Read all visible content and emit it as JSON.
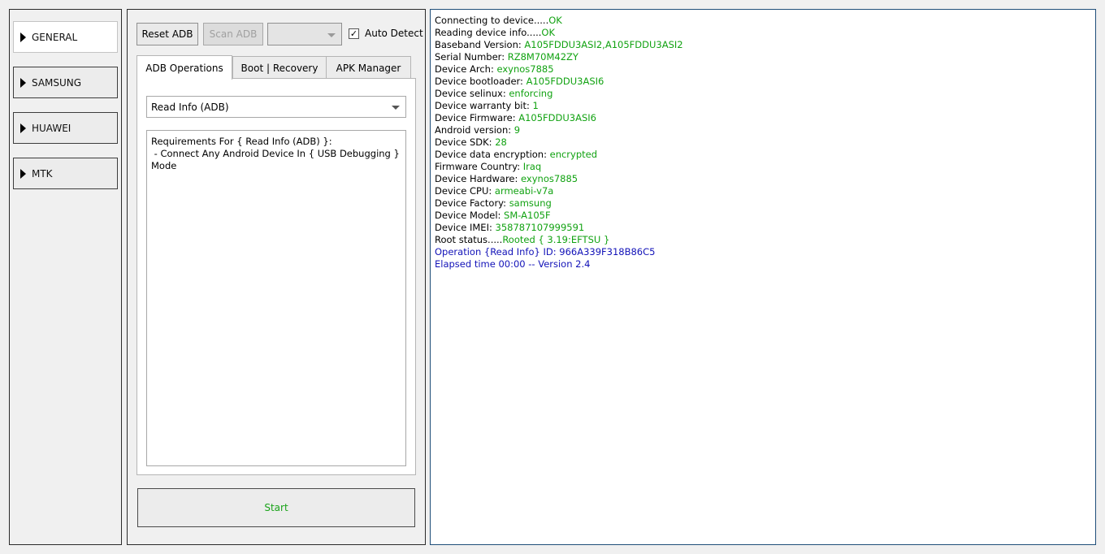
{
  "sidebar": {
    "items": [
      {
        "label": "GENERAL",
        "active": true
      },
      {
        "label": "SAMSUNG",
        "active": false
      },
      {
        "label": "HUAWEI",
        "active": false
      },
      {
        "label": "MTK",
        "active": false
      }
    ]
  },
  "toolbar": {
    "reset_adb": "Reset ADB",
    "scan_adb": "Scan ADB",
    "device_combo_value": "",
    "auto_detect_label": "Auto Detect",
    "auto_detect_checked": true
  },
  "tabs": [
    {
      "label": "ADB Operations",
      "active": true
    },
    {
      "label": "Boot | Recovery",
      "active": false
    },
    {
      "label": "APK Manager",
      "active": false
    }
  ],
  "operation_select": {
    "value": "Read Info (ADB)"
  },
  "requirements_text": "Requirements For { Read Info (ADB) }:\n - Connect Any Android Device In { USB Debugging }\nMode",
  "start_label": "Start",
  "colors": {
    "value_green": "#11a211",
    "info_blue": "#1212b8",
    "start_green": "#1aa31a"
  },
  "log": {
    "lines": [
      {
        "label": "Connecting to device.....",
        "value": "OK"
      },
      {
        "label": "Reading device info.....",
        "value": "OK"
      },
      {
        "label": "Baseband Version: ",
        "value": "A105FDDU3ASI2,A105FDDU3ASI2"
      },
      {
        "label": "Serial Number: ",
        "value": "RZ8M70M42ZY"
      },
      {
        "label": "Device Arch: ",
        "value": "exynos7885"
      },
      {
        "label": "Device bootloader: ",
        "value": "A105FDDU3ASI6"
      },
      {
        "label": "Device selinux: ",
        "value": "enforcing"
      },
      {
        "label": "Device warranty bit: ",
        "value": "1"
      },
      {
        "label": "Device Firmware: ",
        "value": "A105FDDU3ASI6"
      },
      {
        "label": "Android version: ",
        "value": "9"
      },
      {
        "label": "Device SDK: ",
        "value": "28"
      },
      {
        "label": "Device data encryption: ",
        "value": "encrypted"
      },
      {
        "label": "Firmware Country: ",
        "value": "Iraq"
      },
      {
        "label": "Device Hardware: ",
        "value": "exynos7885"
      },
      {
        "label": "Device CPU: ",
        "value": "armeabi-v7a"
      },
      {
        "label": "Device Factory: ",
        "value": "samsung"
      },
      {
        "label": "Device Model: ",
        "value": "SM-A105F"
      },
      {
        "label": "Device IMEI: ",
        "value": "358787107999591"
      },
      {
        "label": "Root status.....",
        "value": "Rooted { 3.19:EFTSU }"
      }
    ],
    "operation_line": "Operation {Read Info} ID: 966A339F318B86C5",
    "elapsed_line": "Elapsed time 00:00 -- Version 2.4"
  }
}
